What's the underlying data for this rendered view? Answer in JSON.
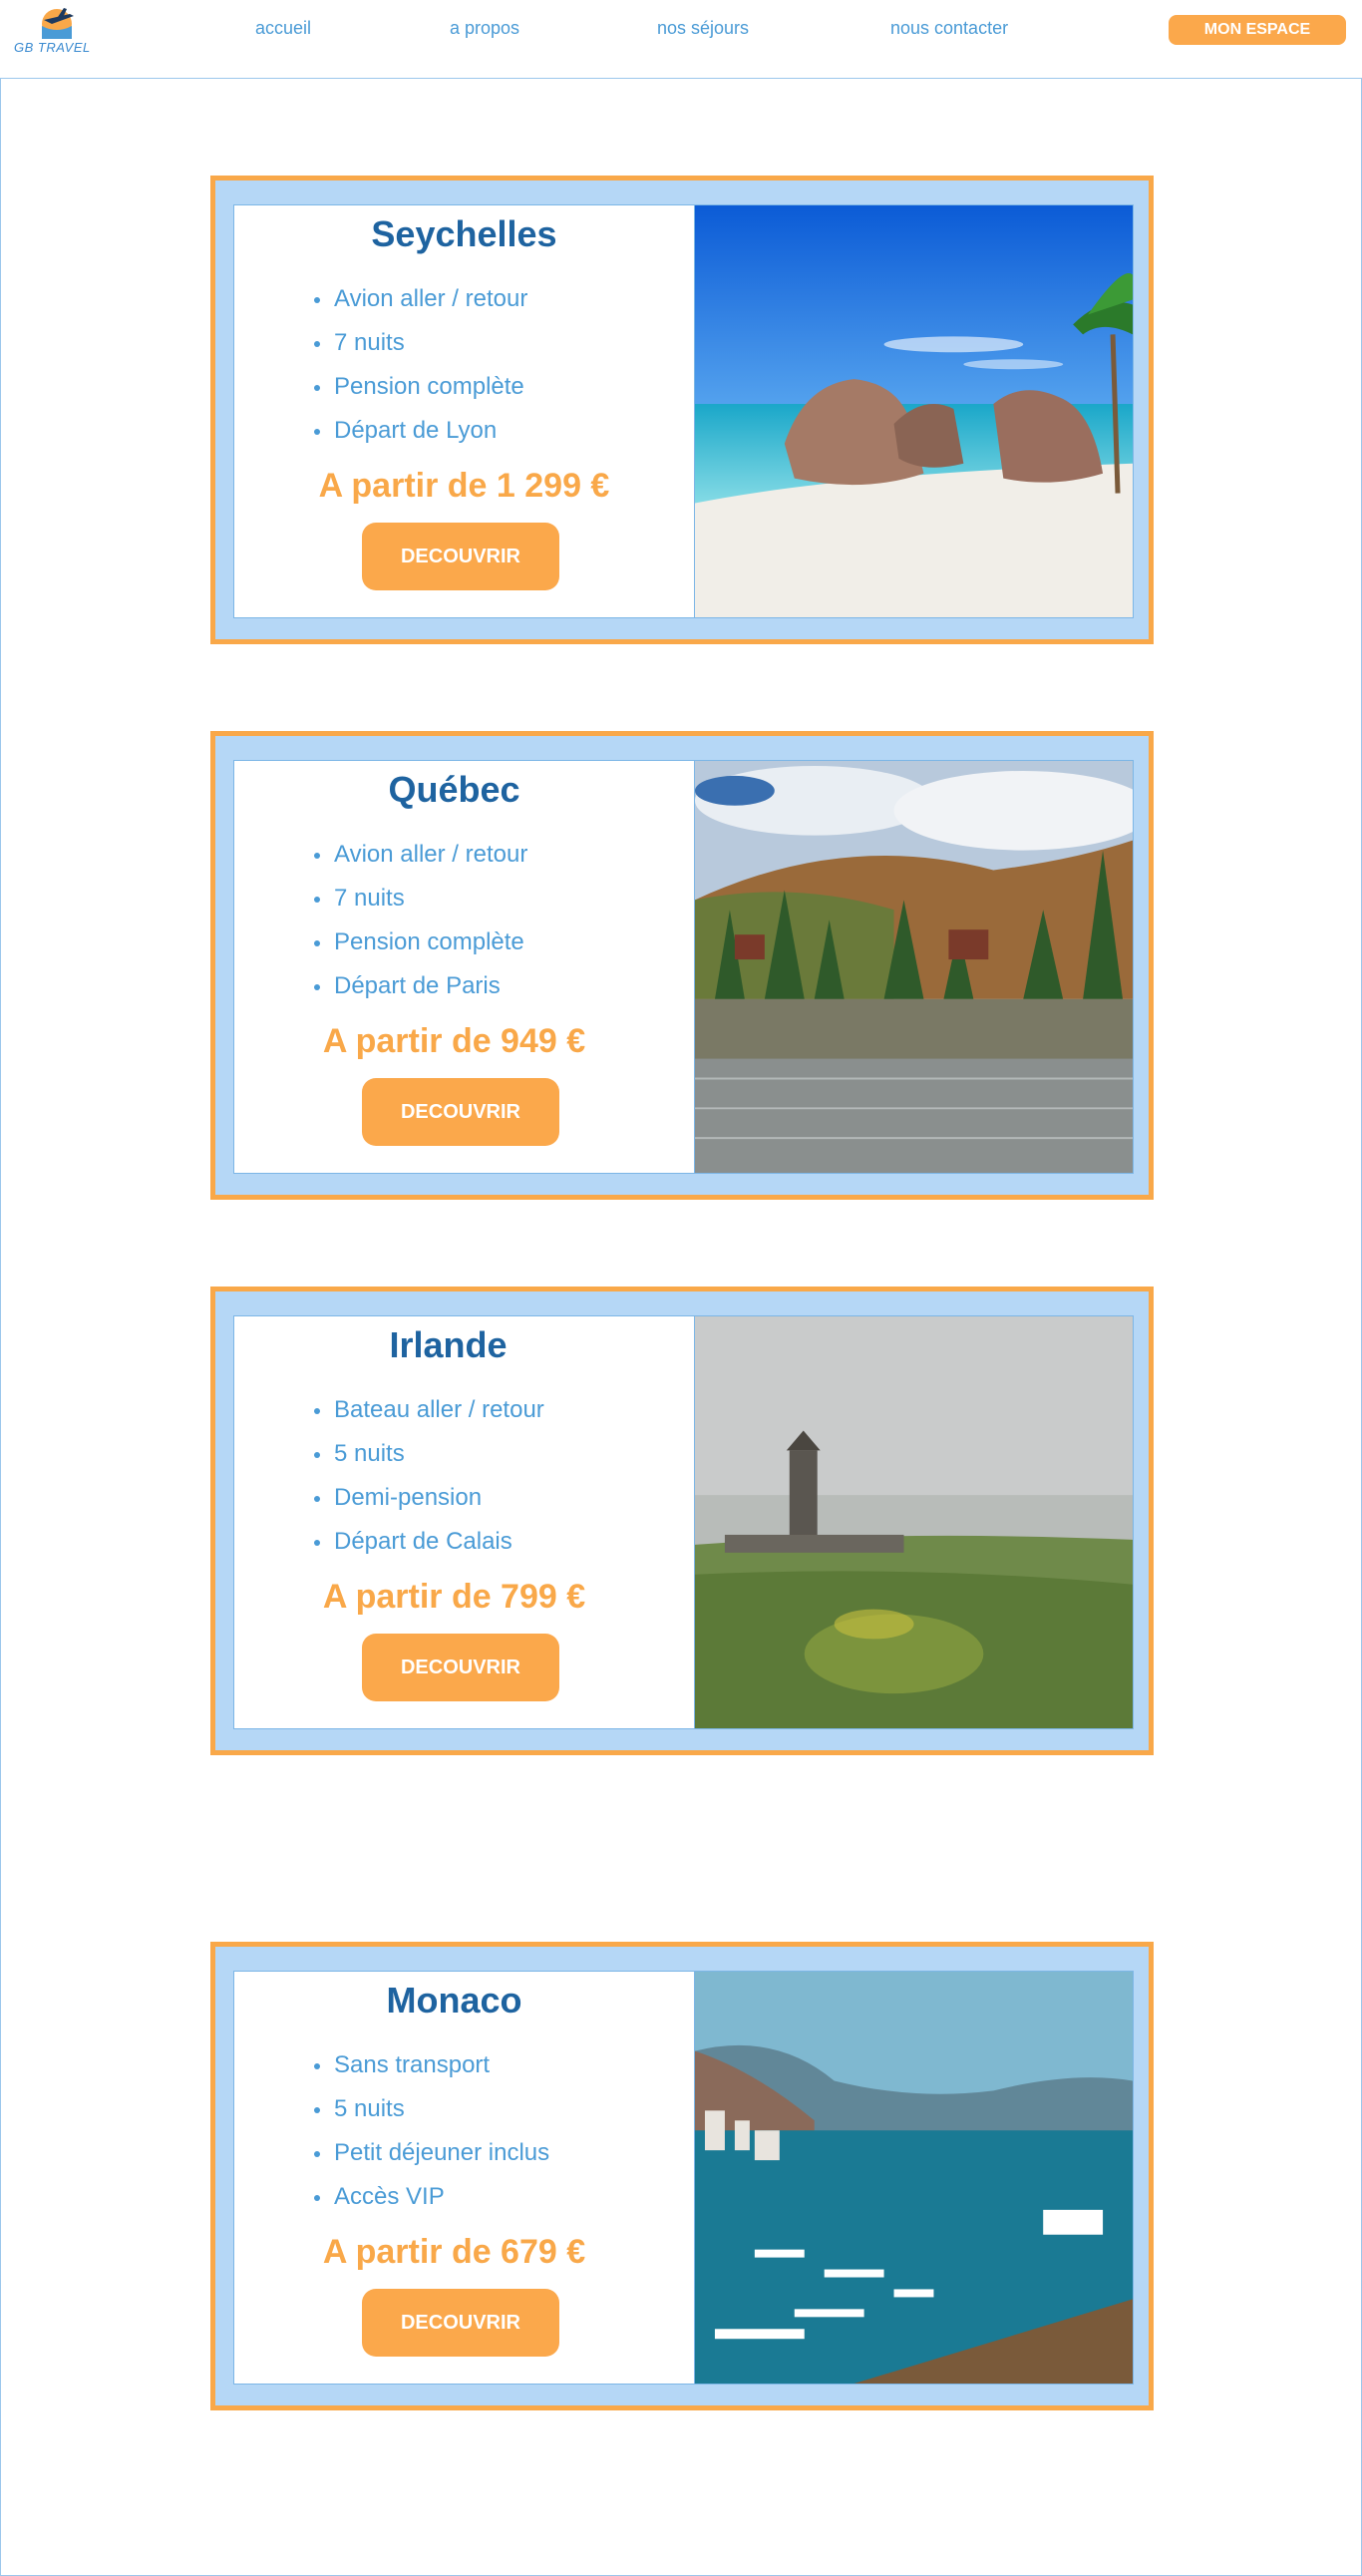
{
  "header": {
    "logo_text": "GB TRAVEL",
    "nav": [
      {
        "label": "accueil"
      },
      {
        "label": "a propos"
      },
      {
        "label": "nos séjours"
      },
      {
        "label": "nous contacter"
      }
    ],
    "espace_label": "MON ESPACE"
  },
  "colors": {
    "accent_orange": "#f9a849",
    "primary_blue": "#1e63a0",
    "text_blue": "#4a9bd6",
    "card_bg": "#b5d7f6"
  },
  "sejours": [
    {
      "title": "Seychelles",
      "features": [
        "Avion aller / retour",
        "7 nuits",
        "Pension complète",
        "Départ de Lyon"
      ],
      "price": "A partir de 1 299 €",
      "button": "DECOUVRIR",
      "image": "beach-rocks-image"
    },
    {
      "title": "Québec",
      "features": [
        "Avion aller / retour",
        "7 nuits",
        "Pension complète",
        "Départ de Paris"
      ],
      "price": "A partir de 949 €",
      "button": "DECOUVRIR",
      "image": "lake-forest-image"
    },
    {
      "title": "Irlande",
      "features": [
        "Bateau aller / retour",
        "5 nuits",
        "Demi-pension",
        "Départ de Calais"
      ],
      "price": "A partir de 799 €",
      "button": "DECOUVRIR",
      "image": "castle-field-image"
    },
    {
      "title": "Monaco",
      "features": [
        "Sans transport",
        "5 nuits",
        "Petit déjeuner inclus",
        "Accès VIP"
      ],
      "price": "A partir de 679 €",
      "button": "DECOUVRIR",
      "image": "harbor-image"
    }
  ]
}
